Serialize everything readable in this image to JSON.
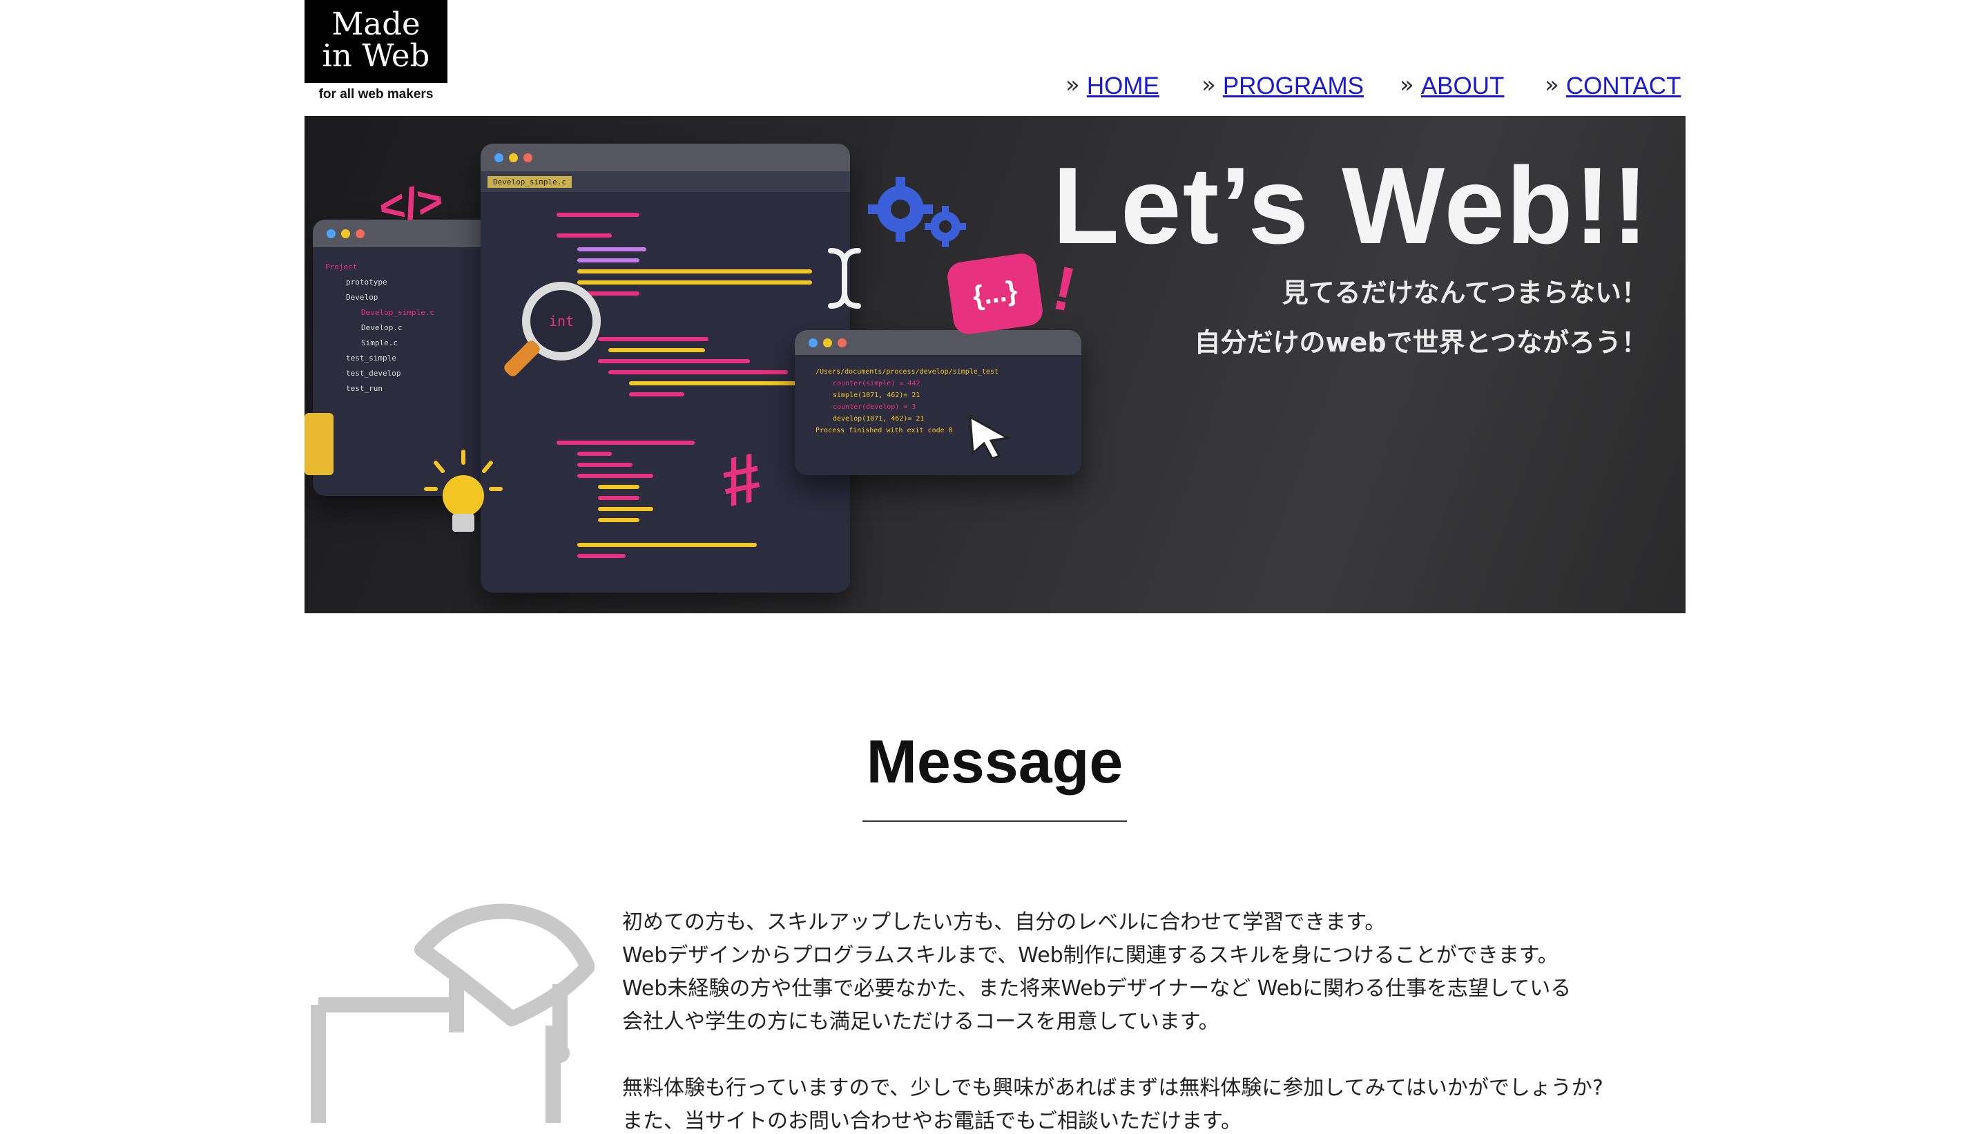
{
  "header": {
    "logo_line1": "Made",
    "logo_line2": "in Web",
    "logo_tagline": "for all web makers",
    "nav": [
      {
        "label": "HOME"
      },
      {
        "label": "PROGRAMS"
      },
      {
        "label": "ABOUT"
      },
      {
        "label": "CONTACT"
      }
    ]
  },
  "hero": {
    "title": "Let’s Web!!",
    "subtitle1": "見てるだけなんてつまらない！",
    "subtitle2": "自分だけのwebで世界とつながろう！",
    "editor_tab": "Develop_simple.c",
    "html_tag_glyph": "</>",
    "bubble_glyph": "{...}",
    "magnifier_text": "int",
    "terminal_path": "/Users/documents/process/develop/simple_test",
    "terminal_lines": [
      "counter(simple) = 442",
      "simple(1071, 462)= 21",
      "counter(develop) = 3",
      "develop(1071, 462)= 21",
      "Process finished with exit code 0"
    ],
    "tree": [
      "Project",
      "prototype",
      "Develop",
      "Develop_simple.c",
      "Develop.c",
      "Simple.c",
      "test_simple",
      "test_develop",
      "test_run"
    ]
  },
  "message": {
    "title": "Message",
    "p1": [
      "初めての方も、スキルアップしたい方も、自分のレベルに合わせて学習できます。",
      "Webデザインからプログラムスキルまで、Web制作に関連するスキルを身につけることができます。",
      "Web未経験の方や仕事で必要なかた、また将来Webデザイナーなど Webに関わる仕事を志望している",
      "会社人や学生の方にも満足いただけるコースを用意しています。"
    ],
    "p2": [
      "無料体験も行っていますので、少しでも興味があればまずは無料体験に参加してみてはいかがでしょうか?",
      "また、当サイトのお問い合わせやお電話でもご相談いただけます。"
    ]
  },
  "colors": {
    "nav_link": "#1a1ad4",
    "accent_pink": "#e8327f",
    "accent_blue": "#3b5fd9",
    "icon_gray": "#c8c8c8"
  }
}
